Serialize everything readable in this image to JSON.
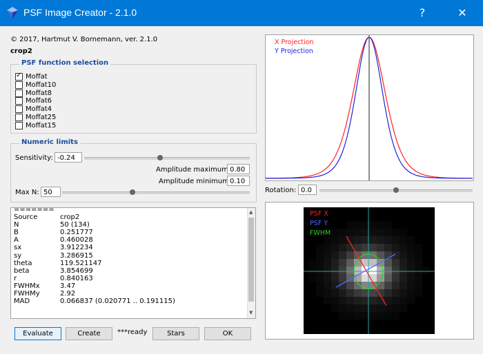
{
  "window": {
    "title": "PSF Image Creator - 2.1.0",
    "help_label": "?",
    "close_label": "✕"
  },
  "copyright": "© 2017, Hartmut V. Bornemann, ver. 2.1.0",
  "image_name": "crop2",
  "psf_group": {
    "title": "PSF function selection",
    "items": [
      {
        "label": "Moffat",
        "checked": true
      },
      {
        "label": "Moffat10",
        "checked": false
      },
      {
        "label": "Moffat8",
        "checked": false
      },
      {
        "label": "Moffat6",
        "checked": false
      },
      {
        "label": "Moffat4",
        "checked": false
      },
      {
        "label": "Moffat25",
        "checked": false
      },
      {
        "label": "Moffat15",
        "checked": false
      }
    ]
  },
  "numeric_group": {
    "title": "Numeric limits",
    "sensitivity_label": "Sensitivity:",
    "sensitivity_value": "-0.24",
    "amp_max_label": "Amplitude maximum",
    "amp_max_value": "0.80",
    "amp_min_label": "Amplitude minimum",
    "amp_min_value": "0.10",
    "maxn_label": "Max N:",
    "maxn_value": "50"
  },
  "results": {
    "rows": [
      {
        "key": "=======",
        "value": ""
      },
      {
        "key": "Source",
        "value": "crop2"
      },
      {
        "key": "N",
        "value": "50 (134)"
      },
      {
        "key": "B",
        "value": "0.251777"
      },
      {
        "key": "A",
        "value": "0.460028"
      },
      {
        "key": "sx",
        "value": "3.912234"
      },
      {
        "key": "sy",
        "value": "3.286915"
      },
      {
        "key": "theta",
        "value": "119.521147"
      },
      {
        "key": "beta",
        "value": "3.854699"
      },
      {
        "key": "r",
        "value": "0.840163"
      },
      {
        "key": "FWHMx",
        "value": "3.47"
      },
      {
        "key": "FWHMy",
        "value": "2.92"
      },
      {
        "key": "MAD",
        "value": "0.066837 (0.020771 .. 0.191115)"
      }
    ]
  },
  "buttons": {
    "evaluate": "Evaluate",
    "create": "Create",
    "status": "***ready",
    "stars": "Stars",
    "ok": "OK"
  },
  "projection_chart": {
    "legend_x": "X Projection",
    "legend_y": "Y Projection",
    "colors": {
      "x": "#ff2020",
      "y": "#2020dd",
      "center": "#404040"
    }
  },
  "rotation": {
    "label": "Rotation:",
    "value": "0.0"
  },
  "psf_view": {
    "legend_x": "PSF X",
    "legend_y": "PSF Y",
    "legend_fwhm": "FWHM",
    "colors": {
      "x": "#ff2020",
      "y": "#4a6cff",
      "fwhm": "#33cc33",
      "cross": "#2aa7a7"
    }
  }
}
